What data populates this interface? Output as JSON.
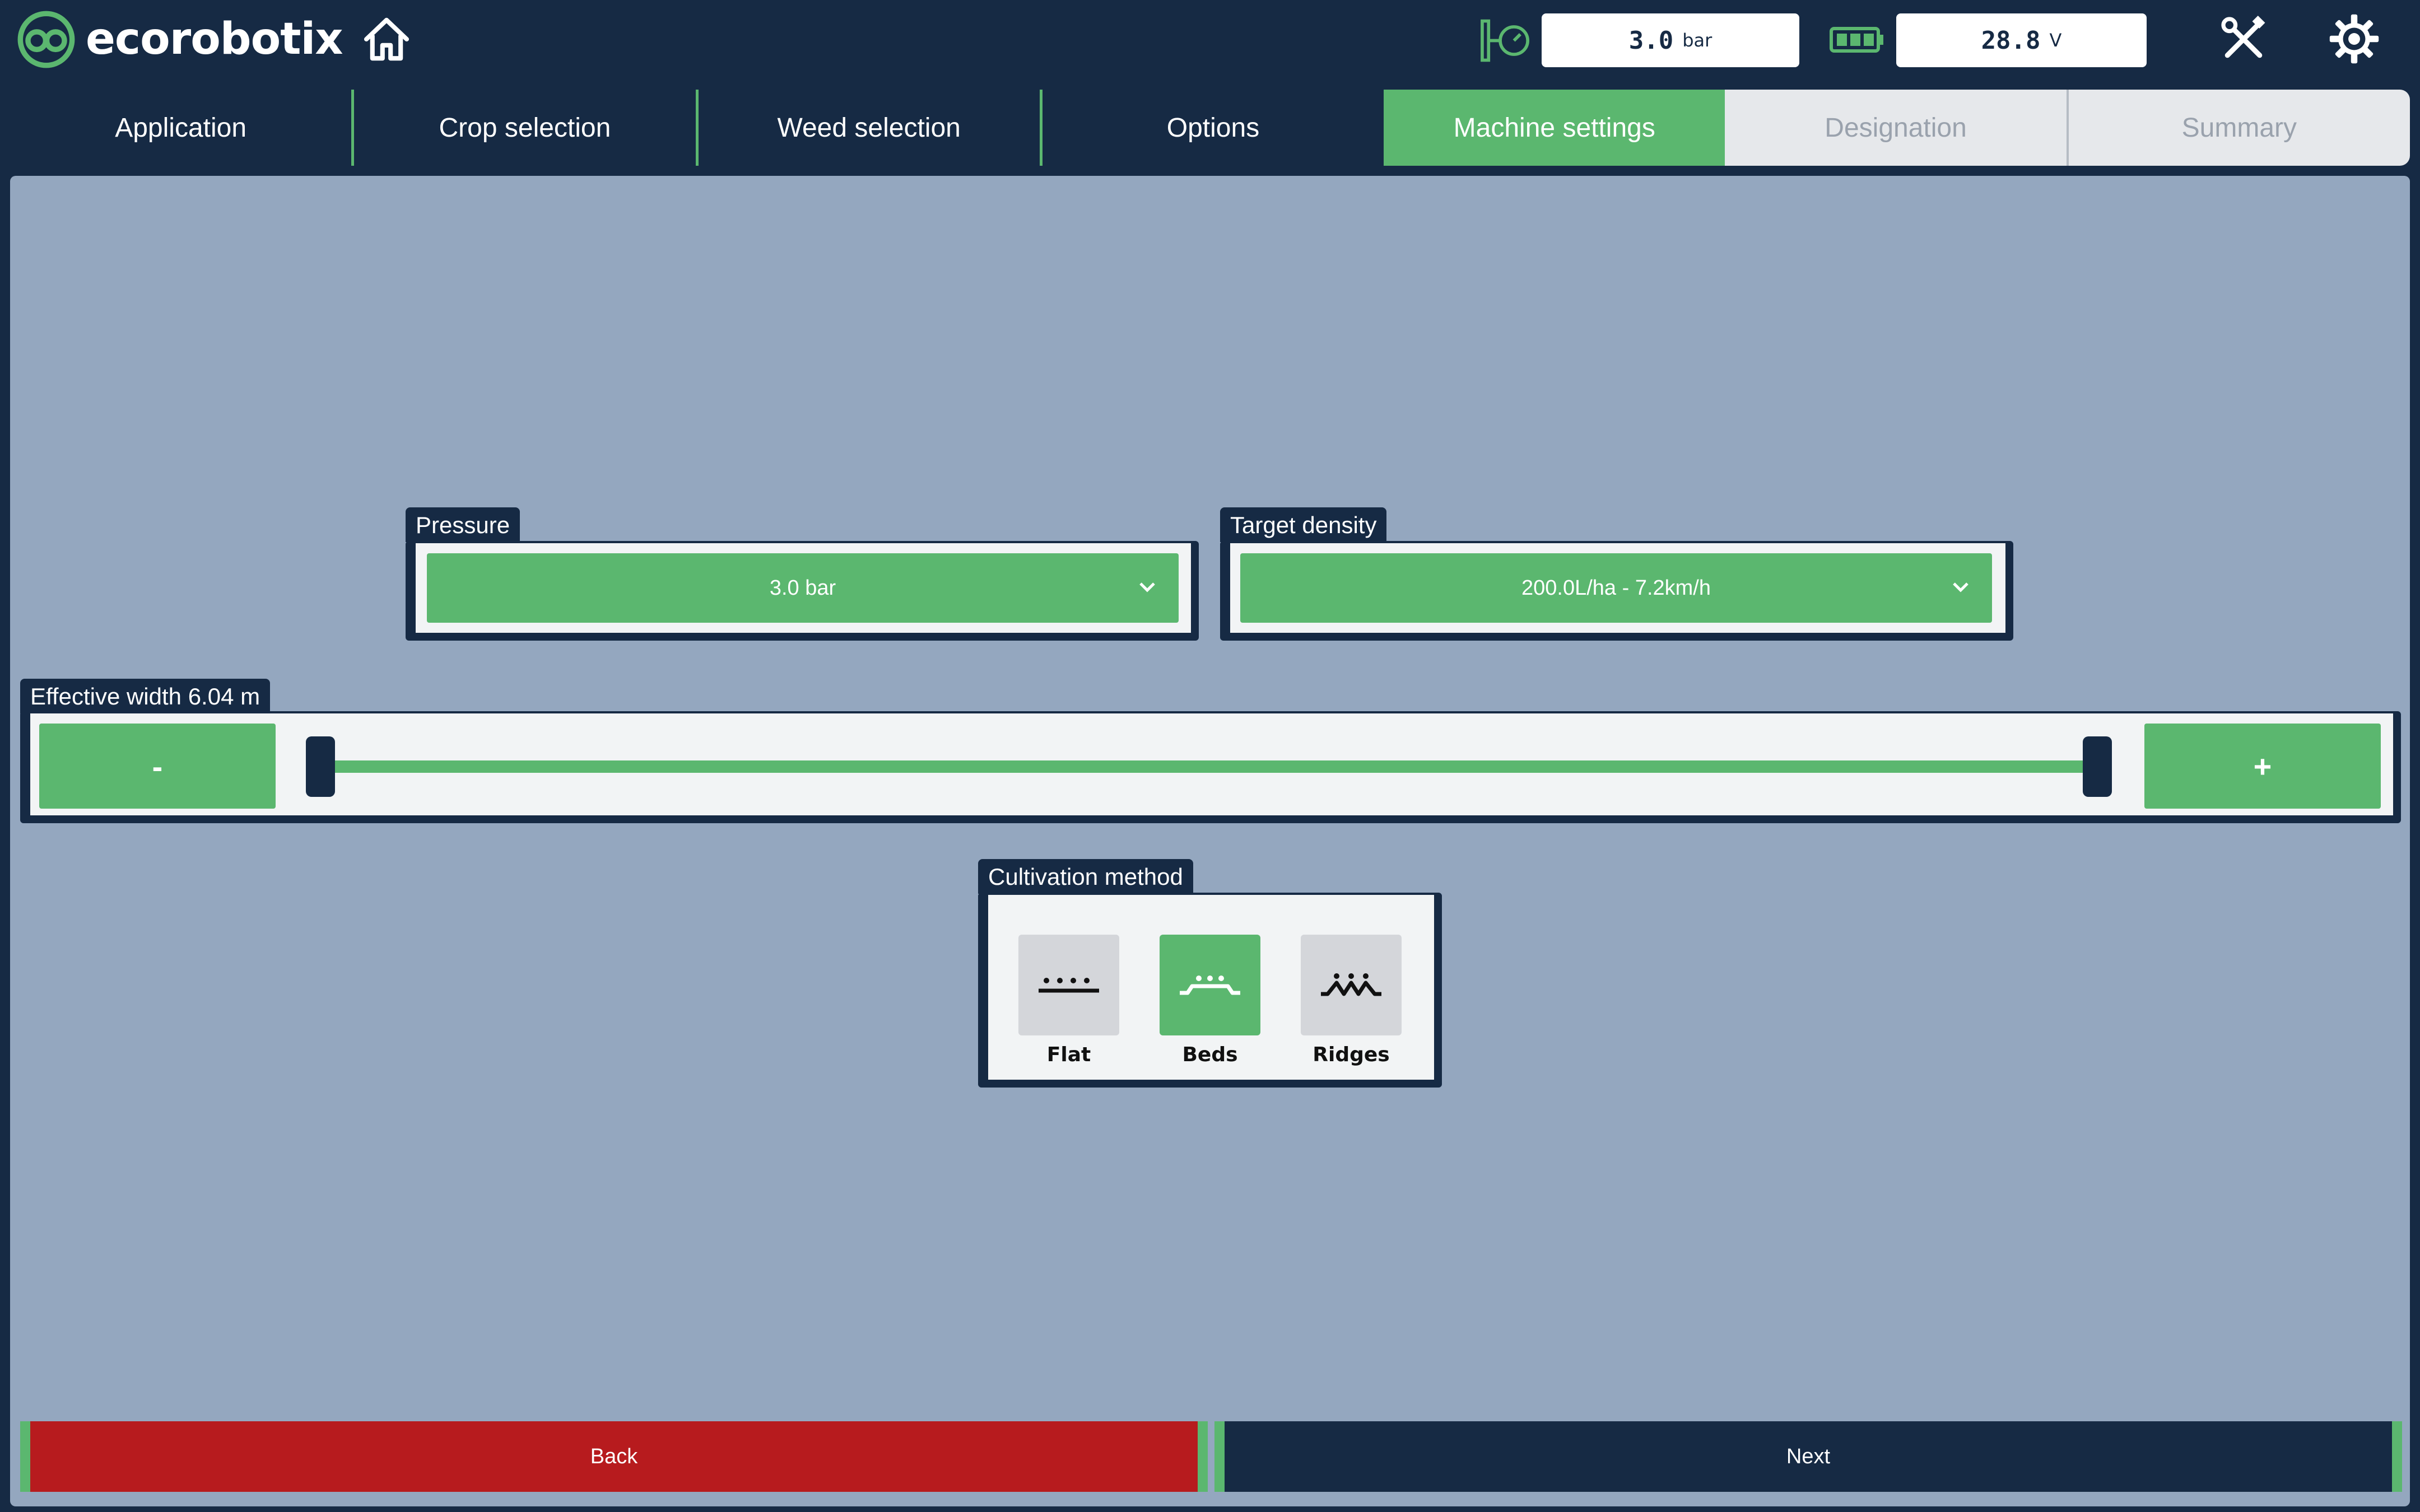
{
  "app": {
    "brand": "ecorobotix"
  },
  "status": {
    "pressure_value": "3.0",
    "pressure_unit": "bar",
    "voltage_value": "28.8",
    "voltage_unit": "V"
  },
  "tabs": [
    {
      "label": "Application",
      "state": "done"
    },
    {
      "label": "Crop selection",
      "state": "done"
    },
    {
      "label": "Weed selection",
      "state": "done"
    },
    {
      "label": "Options",
      "state": "done"
    },
    {
      "label": "Machine settings",
      "state": "active"
    },
    {
      "label": "Designation",
      "state": "disabled"
    },
    {
      "label": "Summary",
      "state": "disabled"
    }
  ],
  "pressure": {
    "label": "Pressure",
    "selected": "3.0 bar"
  },
  "target_density": {
    "label": "Target density",
    "selected": "200.0L/ha - 7.2km/h"
  },
  "effective_width": {
    "label": "Effective width 6.04 m",
    "minus_label": "-",
    "plus_label": "+"
  },
  "cultivation": {
    "label": "Cultivation method",
    "options": [
      {
        "label": "Flat",
        "icon": "flat-field-icon"
      },
      {
        "label": "Beds",
        "icon": "beds-field-icon",
        "selected": true
      },
      {
        "label": "Ridges",
        "icon": "ridges-field-icon"
      }
    ]
  },
  "footer": {
    "back_label": "Back",
    "next_label": "Next"
  },
  "colors": {
    "navy": "#162a44",
    "green": "#5bb76f",
    "panel": "#94a7bf",
    "red": "#b71b1e"
  }
}
